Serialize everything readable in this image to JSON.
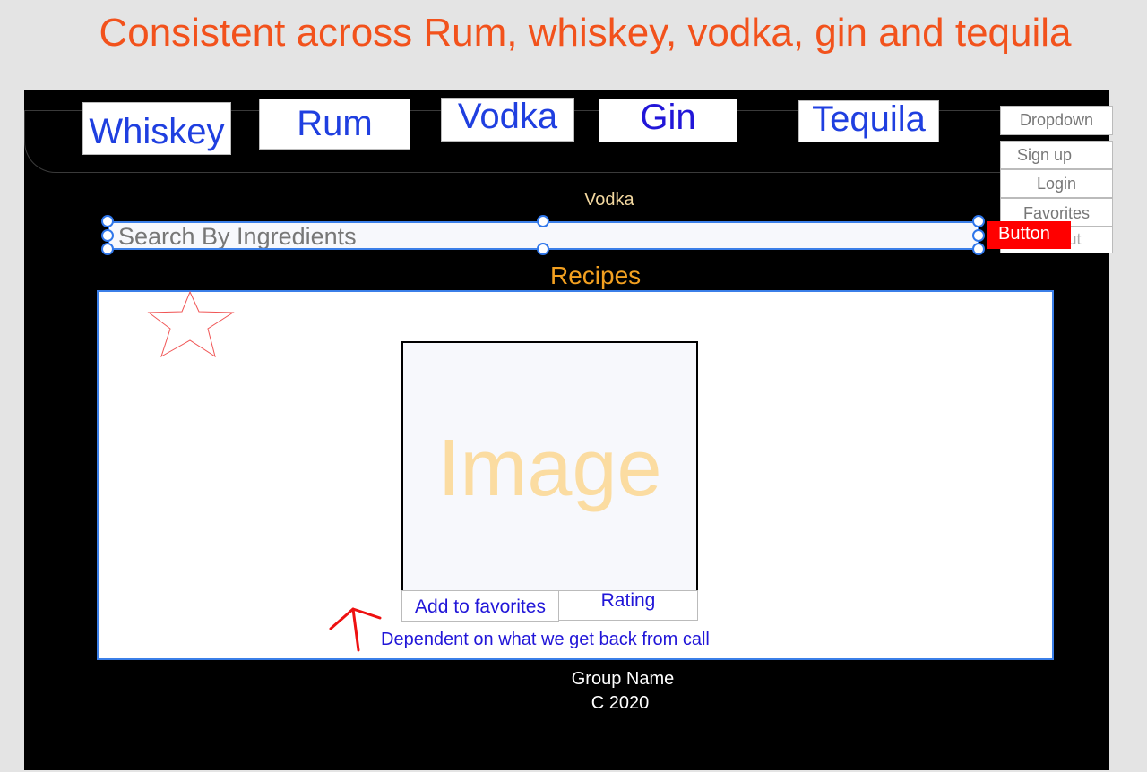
{
  "headline": "Consistent across Rum, whiskey, vodka, gin and tequila",
  "nav": {
    "tabs": [
      {
        "label": "Whiskey"
      },
      {
        "label": "Rum"
      },
      {
        "label": "Vodka"
      },
      {
        "label": "Gin"
      },
      {
        "label": "Tequila"
      }
    ]
  },
  "dropdown": {
    "label": "Dropdown",
    "items": [
      "Sign up",
      "Login",
      "Favorites",
      "Logout"
    ]
  },
  "page": {
    "subtitle": "Vodka",
    "section_title": "Recipes"
  },
  "search": {
    "placeholder": "Search By Ingredients",
    "button_label": "Button"
  },
  "recipe_card": {
    "image_placeholder": "Image",
    "add_favorites_label": "Add to favorites",
    "rating_label": "Rating",
    "star_icon": "star-icon"
  },
  "annotation": {
    "note": "Dependent on what we get back from call",
    "arrow_icon": "arrow-up-icon"
  },
  "footer": {
    "group_name": "Group Name",
    "copyright": "C 2020"
  },
  "colors": {
    "headline": "#f2521c",
    "tab_text": "#1f3fe0",
    "button_bg": "#ff0000",
    "accent_blue": "#3b7fe8"
  }
}
